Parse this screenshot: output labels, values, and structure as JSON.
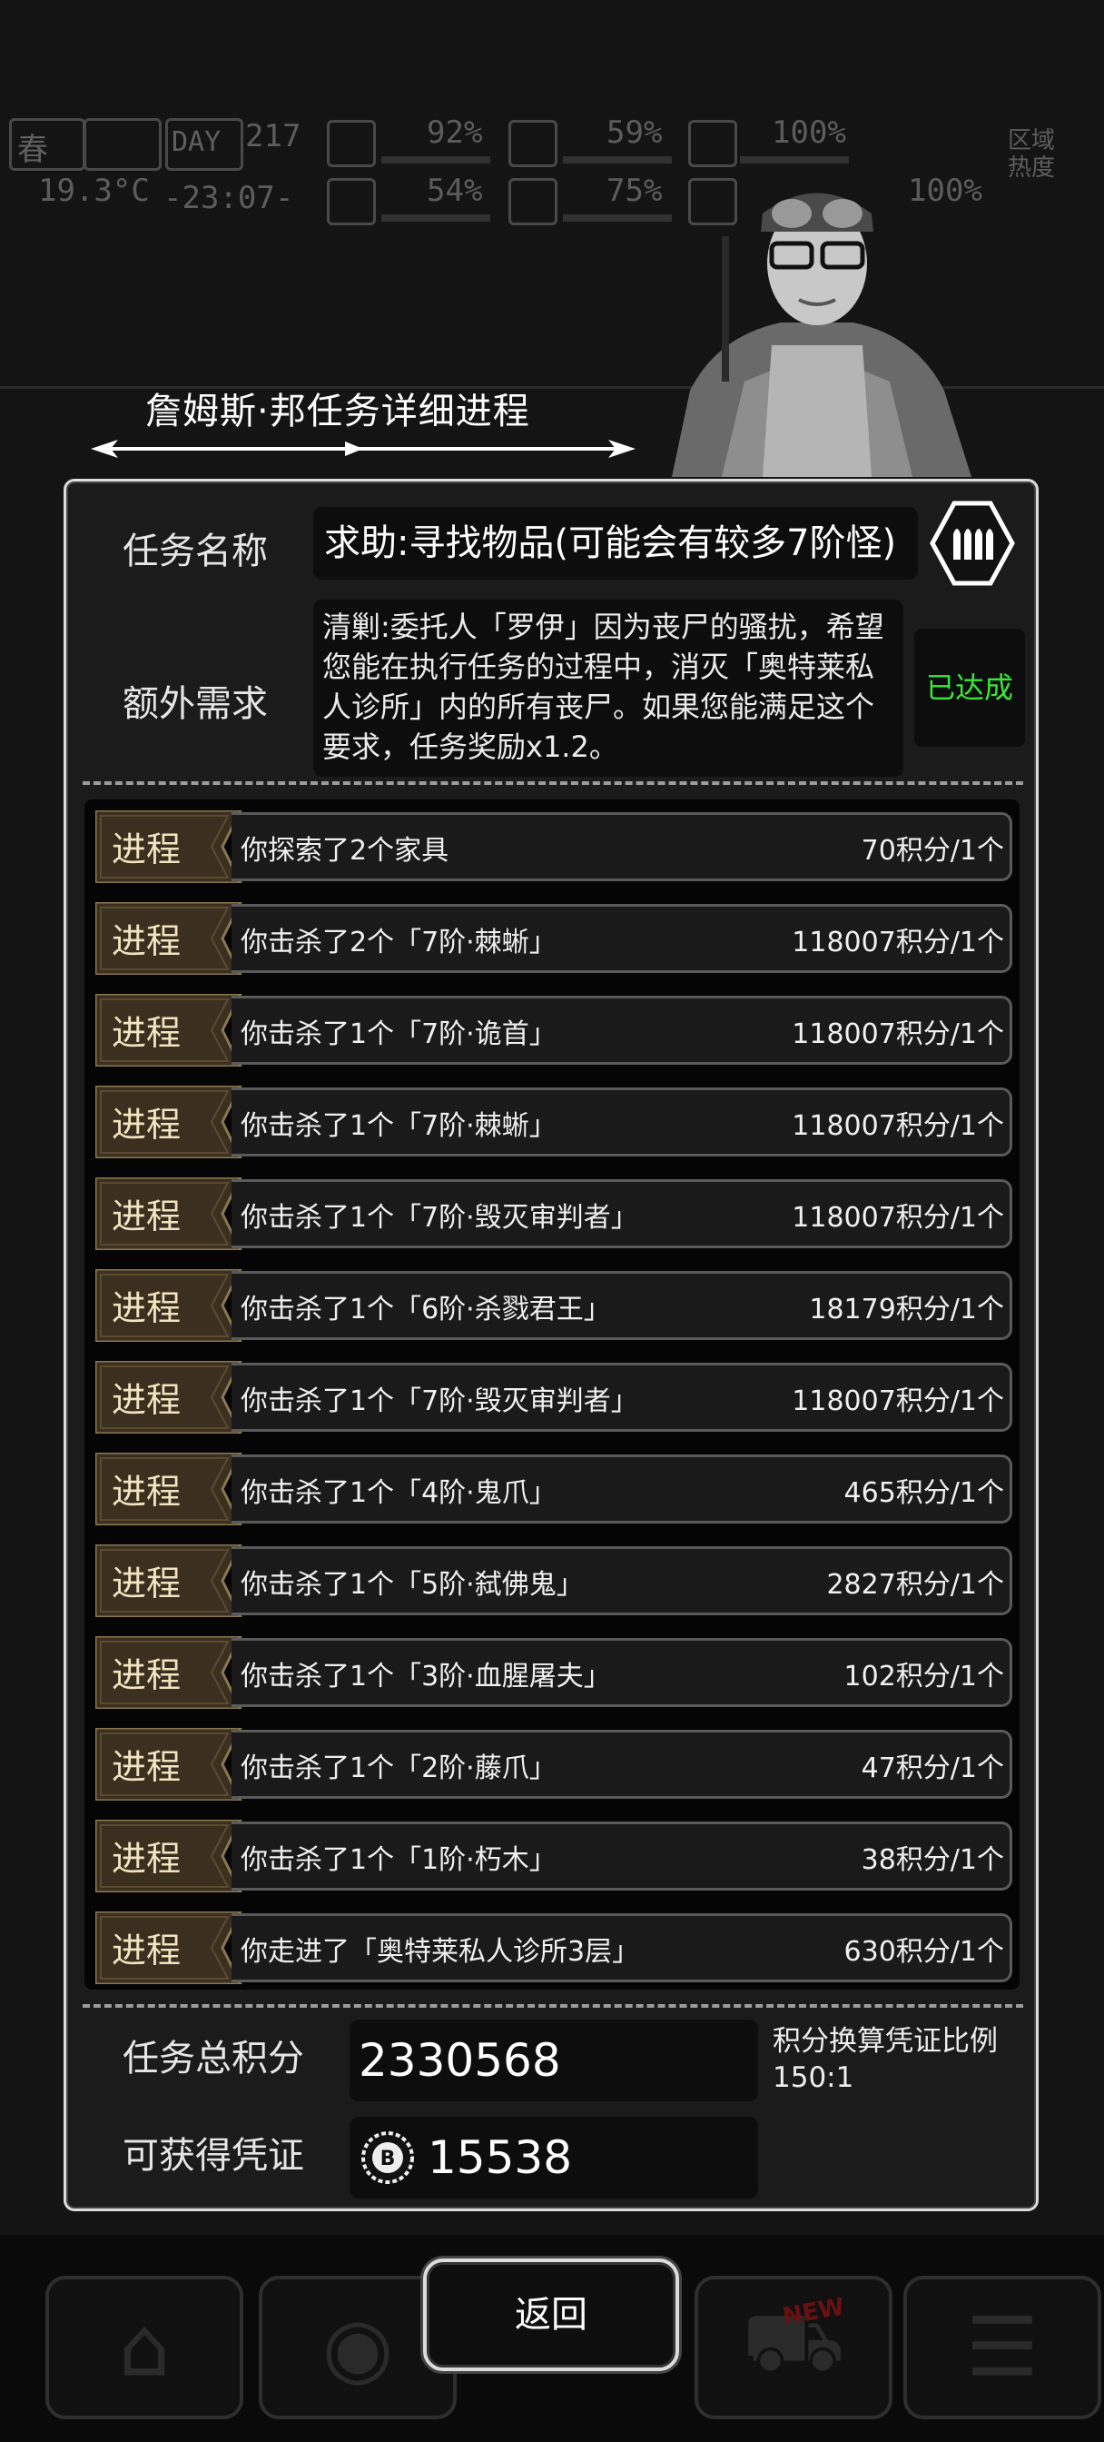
{
  "hud": {
    "season": "春",
    "temperature": "19.3°C",
    "day_label": "DAY",
    "day": "217",
    "time": "-23:07-",
    "stats": [
      "92%",
      "59%",
      "100%",
      "54%",
      "75%",
      "100%"
    ],
    "region_heat_label": "区域热度"
  },
  "dialog": {
    "title": "詹姆斯·邦任务详细进程",
    "mission_name_label": "任务名称",
    "mission_name": "求助:寻找物品(可能会有较多7阶怪)",
    "mission_icon": "ammo-icon",
    "extra_req_label": "额外需求",
    "extra_req_text": "清剿:委托人「罗伊」因为丧尸的骚扰，希望您能在执行任务的过程中，消灭「奥特莱私人诊所」内的所有丧尸。如果您能满足这个要求，任务奖励x1.2。",
    "extra_req_status": "已达成",
    "status_color": "#39e639",
    "progress_tag": "进程",
    "progress": [
      {
        "desc": "你探索了2个家具",
        "score": "70积分/1个"
      },
      {
        "desc": "你击杀了2个「7阶·棘蜥」",
        "score": "118007积分/1个"
      },
      {
        "desc": "你击杀了1个「7阶·诡首」",
        "score": "118007积分/1个"
      },
      {
        "desc": "你击杀了1个「7阶·棘蜥」",
        "score": "118007积分/1个"
      },
      {
        "desc": "你击杀了1个「7阶·毁灭审判者」",
        "score": "118007积分/1个"
      },
      {
        "desc": "你击杀了1个「6阶·杀戮君王」",
        "score": "18179积分/1个"
      },
      {
        "desc": "你击杀了1个「7阶·毁灭审判者」",
        "score": "118007积分/1个"
      },
      {
        "desc": "你击杀了1个「4阶·鬼爪」",
        "score": "465积分/1个"
      },
      {
        "desc": "你击杀了1个「5阶·弑佛鬼」",
        "score": "2827积分/1个"
      },
      {
        "desc": "你击杀了1个「3阶·血腥屠夫」",
        "score": "102积分/1个"
      },
      {
        "desc": "你击杀了1个「2阶·藤爪」",
        "score": "47积分/1个"
      },
      {
        "desc": "你击杀了1个「1阶·朽木」",
        "score": "38积分/1个"
      },
      {
        "desc": "你走进了「奥特莱私人诊所3层」",
        "score": "630积分/1个"
      }
    ],
    "total_label": "任务总积分",
    "total_value": "2330568",
    "ratio_label": "积分换算凭证比例",
    "ratio_value": "150:1",
    "voucher_label": "可获得凭证",
    "voucher_icon": "coin-icon",
    "voucher_value": "15538"
  },
  "back_button": "返回",
  "bottom_bar": {
    "icons": [
      "backpack-icon",
      "brain-icon",
      "cart-icon",
      "menu-icon"
    ],
    "new_badge": "NEW"
  }
}
